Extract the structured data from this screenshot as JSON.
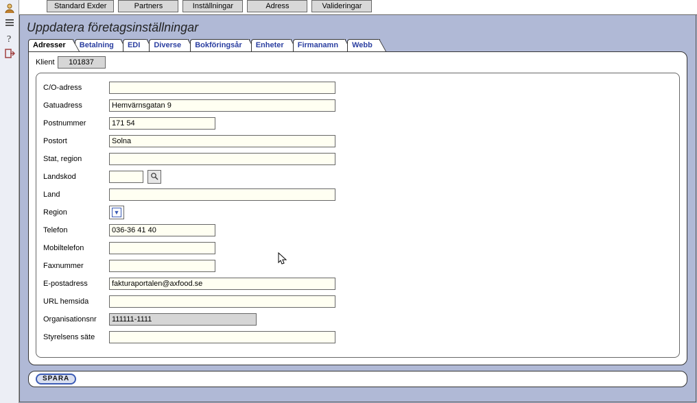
{
  "topnav": {
    "buttons": [
      "Standard Exder",
      "Partners",
      "Inställningar",
      "Adress",
      "Valideringar"
    ]
  },
  "page_title": "Uppdatera företagsinställningar",
  "tabs": [
    "Adresser",
    "Betalning",
    "EDI",
    "Diverse",
    "Bokföringsår",
    "Enheter",
    "Firmanamn",
    "Webb"
  ],
  "active_tab_index": 0,
  "klient": {
    "label": "Klient",
    "value": "101837"
  },
  "fields": {
    "co_adress": {
      "label": "C/O-adress",
      "value": ""
    },
    "gatuadress": {
      "label": "Gatuadress",
      "value": "Hemvärnsgatan 9"
    },
    "postnummer": {
      "label": "Postnummer",
      "value": "171 54"
    },
    "postort": {
      "label": "Postort",
      "value": "Solna"
    },
    "stat_region": {
      "label": "Stat, region",
      "value": ""
    },
    "landskod": {
      "label": "Landskod",
      "value": ""
    },
    "land": {
      "label": "Land",
      "value": ""
    },
    "region": {
      "label": "Region",
      "value": ""
    },
    "telefon": {
      "label": "Telefon",
      "value": "036-36 41 40"
    },
    "mobiltelefon": {
      "label": "Mobiltelefon",
      "value": ""
    },
    "faxnummer": {
      "label": "Faxnummer",
      "value": ""
    },
    "epostadress": {
      "label": "E-postadress",
      "value": "fakturaportalen@axfood.se"
    },
    "url_hemsida": {
      "label": "URL hemsida",
      "value": ""
    },
    "organisationsnr": {
      "label": "Organisationsnr",
      "value": "111111-1111"
    },
    "styrelsens_sate": {
      "label": "Styrelsens säte",
      "value": ""
    }
  },
  "footer": {
    "spara": "SPARA"
  }
}
